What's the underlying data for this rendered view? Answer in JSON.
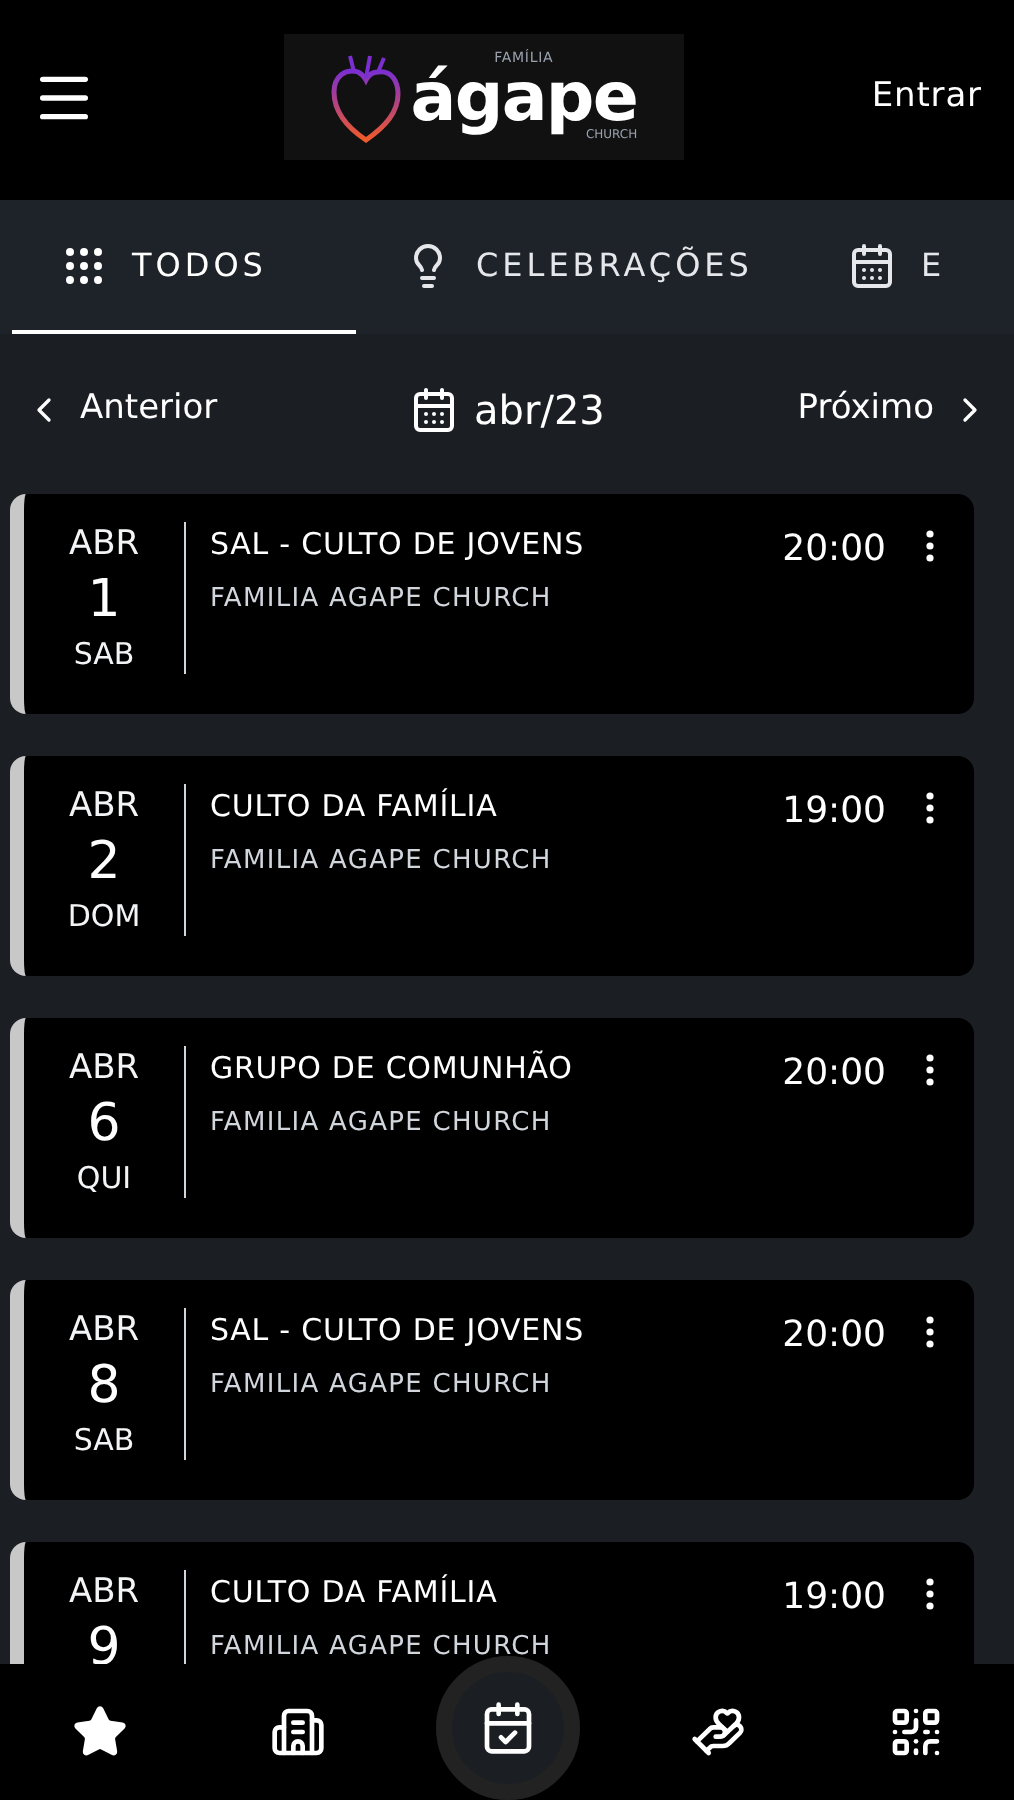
{
  "header": {
    "logo": {
      "top": "FAMÍLIA",
      "word": "ágape",
      "bottom": "CHURCH"
    },
    "login": "Entrar"
  },
  "tabs": [
    {
      "kind": "grid",
      "label": "TODOS",
      "selected": true
    },
    {
      "kind": "bulb",
      "label": "CELEBRAÇÕES",
      "selected": false
    },
    {
      "kind": "calendar",
      "label": "E",
      "selected": false
    }
  ],
  "month_nav": {
    "previous": "Anterior",
    "month": "abr/23",
    "next": "Próximo"
  },
  "events": [
    {
      "month": "ABR",
      "day": "1",
      "weekday": "SAB",
      "title": "SAL - CULTO DE JOVENS",
      "place": "FAMILIA AGAPE CHURCH",
      "time": "20:00"
    },
    {
      "month": "ABR",
      "day": "2",
      "weekday": "DOM",
      "title": "CULTO DA FAMÍLIA",
      "place": "FAMILIA AGAPE CHURCH",
      "time": "19:00"
    },
    {
      "month": "ABR",
      "day": "6",
      "weekday": "QUI",
      "title": "GRUPO DE COMUNHÃO",
      "place": "FAMILIA AGAPE CHURCH",
      "time": "20:00"
    },
    {
      "month": "ABR",
      "day": "8",
      "weekday": "SAB",
      "title": "SAL - CULTO DE JOVENS",
      "place": "FAMILIA AGAPE CHURCH",
      "time": "20:00"
    },
    {
      "month": "ABR",
      "day": "9",
      "title": "CULTO DA FAMÍLIA",
      "place": "FAMILIA AGAPE CHURCH",
      "time": "19:00"
    }
  ],
  "bottom_nav": [
    {
      "kind": "star",
      "selected": false
    },
    {
      "kind": "building",
      "selected": false
    },
    {
      "kind": "calendar",
      "selected": true
    },
    {
      "kind": "charity",
      "selected": false
    },
    {
      "kind": "qr",
      "selected": false
    }
  ]
}
